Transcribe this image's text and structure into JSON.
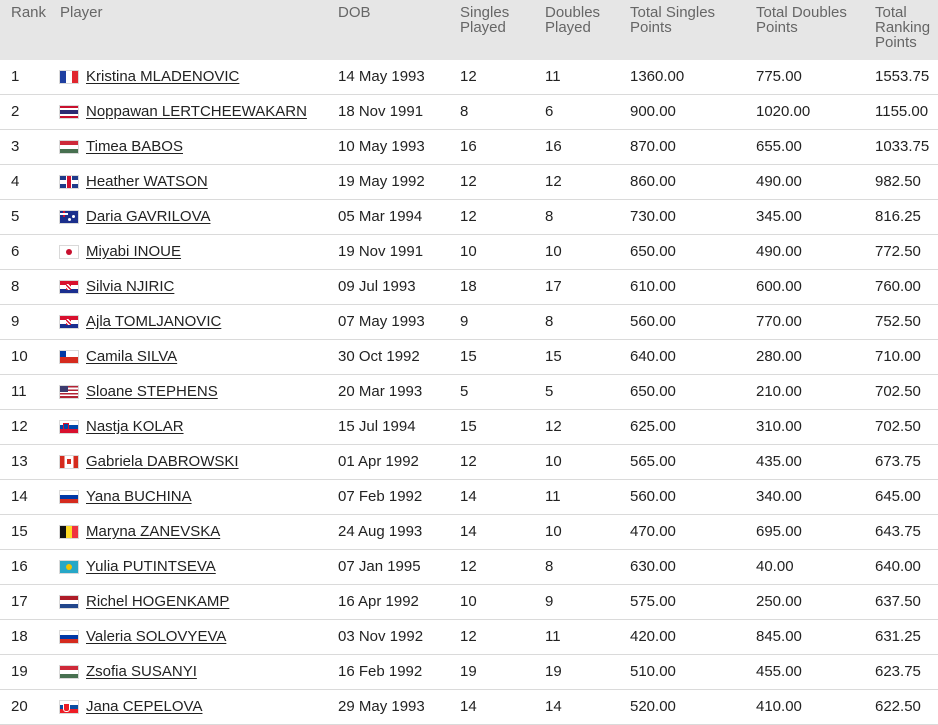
{
  "headers": {
    "rank": "Rank",
    "player": "Player",
    "dob": "DOB",
    "singles_played": "Singles\nPlayed",
    "doubles_played": "Doubles\nPlayed",
    "total_singles": "Total Singles\nPoints",
    "total_doubles": "Total Doubles\nPoints",
    "total_ranking": "Total\nRanking\nPoints"
  },
  "rows": [
    {
      "rank": "1",
      "flag": "fr",
      "flag_icon": "france-flag-icon",
      "player": "Kristina MLADENOVIC",
      "dob": "14 May 1993",
      "singles_played": "12",
      "doubles_played": "11",
      "total_singles": "1360.00",
      "total_doubles": "775.00",
      "total_ranking": "1553.75"
    },
    {
      "rank": "2",
      "flag": "th",
      "flag_icon": "thailand-flag-icon",
      "player": "Noppawan LERTCHEEWAKARN",
      "dob": "18 Nov 1991",
      "singles_played": "8",
      "doubles_played": "6",
      "total_singles": "900.00",
      "total_doubles": "1020.00",
      "total_ranking": "1155.00"
    },
    {
      "rank": "3",
      "flag": "hu",
      "flag_icon": "hungary-flag-icon",
      "player": "Timea BABOS",
      "dob": "10 May 1993",
      "singles_played": "16",
      "doubles_played": "16",
      "total_singles": "870.00",
      "total_doubles": "655.00",
      "total_ranking": "1033.75"
    },
    {
      "rank": "4",
      "flag": "gb",
      "flag_icon": "great-britain-flag-icon",
      "player": "Heather WATSON",
      "dob": "19 May 1992",
      "singles_played": "12",
      "doubles_played": "12",
      "total_singles": "860.00",
      "total_doubles": "490.00",
      "total_ranking": "982.50"
    },
    {
      "rank": "5",
      "flag": "au",
      "flag_icon": "australia-flag-icon",
      "player": "Daria GAVRILOVA",
      "dob": "05 Mar 1994",
      "singles_played": "12",
      "doubles_played": "8",
      "total_singles": "730.00",
      "total_doubles": "345.00",
      "total_ranking": "816.25"
    },
    {
      "rank": "6",
      "flag": "jp",
      "flag_icon": "japan-flag-icon",
      "player": "Miyabi INOUE",
      "dob": "19 Nov 1991",
      "singles_played": "10",
      "doubles_played": "10",
      "total_singles": "650.00",
      "total_doubles": "490.00",
      "total_ranking": "772.50"
    },
    {
      "rank": "8",
      "flag": "hr",
      "flag_icon": "croatia-flag-icon",
      "player": "Silvia NJIRIC",
      "dob": "09 Jul 1993",
      "singles_played": "18",
      "doubles_played": "17",
      "total_singles": "610.00",
      "total_doubles": "600.00",
      "total_ranking": "760.00"
    },
    {
      "rank": "9",
      "flag": "hr",
      "flag_icon": "croatia-flag-icon",
      "player": "Ajla TOMLJANOVIC",
      "dob": "07 May 1993",
      "singles_played": "9",
      "doubles_played": "8",
      "total_singles": "560.00",
      "total_doubles": "770.00",
      "total_ranking": "752.50"
    },
    {
      "rank": "10",
      "flag": "cl",
      "flag_icon": "chile-flag-icon",
      "player": "Camila SILVA",
      "dob": "30 Oct 1992",
      "singles_played": "15",
      "doubles_played": "15",
      "total_singles": "640.00",
      "total_doubles": "280.00",
      "total_ranking": "710.00"
    },
    {
      "rank": "11",
      "flag": "us",
      "flag_icon": "usa-flag-icon",
      "player": "Sloane STEPHENS",
      "dob": "20 Mar 1993",
      "singles_played": "5",
      "doubles_played": "5",
      "total_singles": "650.00",
      "total_doubles": "210.00",
      "total_ranking": "702.50"
    },
    {
      "rank": "12",
      "flag": "si",
      "flag_icon": "slovenia-flag-icon",
      "player": "Nastja KOLAR",
      "dob": "15 Jul 1994",
      "singles_played": "15",
      "doubles_played": "12",
      "total_singles": "625.00",
      "total_doubles": "310.00",
      "total_ranking": "702.50"
    },
    {
      "rank": "13",
      "flag": "ca",
      "flag_icon": "canada-flag-icon",
      "player": "Gabriela DABROWSKI",
      "dob": "01 Apr 1992",
      "singles_played": "12",
      "doubles_played": "10",
      "total_singles": "565.00",
      "total_doubles": "435.00",
      "total_ranking": "673.75"
    },
    {
      "rank": "14",
      "flag": "ru",
      "flag_icon": "russia-flag-icon",
      "player": "Yana BUCHINA",
      "dob": "07 Feb 1992",
      "singles_played": "14",
      "doubles_played": "11",
      "total_singles": "560.00",
      "total_doubles": "340.00",
      "total_ranking": "645.00"
    },
    {
      "rank": "15",
      "flag": "be",
      "flag_icon": "belgium-flag-icon",
      "player": "Maryna ZANEVSKA",
      "dob": "24 Aug 1993",
      "singles_played": "14",
      "doubles_played": "10",
      "total_singles": "470.00",
      "total_doubles": "695.00",
      "total_ranking": "643.75"
    },
    {
      "rank": "16",
      "flag": "kz",
      "flag_icon": "kazakhstan-flag-icon",
      "player": "Yulia PUTINTSEVA",
      "dob": "07 Jan 1995",
      "singles_played": "12",
      "doubles_played": "8",
      "total_singles": "630.00",
      "total_doubles": "40.00",
      "total_ranking": "640.00"
    },
    {
      "rank": "17",
      "flag": "nl",
      "flag_icon": "netherlands-flag-icon",
      "player": "Richel HOGENKAMP",
      "dob": "16 Apr 1992",
      "singles_played": "10",
      "doubles_played": "9",
      "total_singles": "575.00",
      "total_doubles": "250.00",
      "total_ranking": "637.50"
    },
    {
      "rank": "18",
      "flag": "ru",
      "flag_icon": "russia-flag-icon",
      "player": "Valeria SOLOVYEVA",
      "dob": "03 Nov 1992",
      "singles_played": "12",
      "doubles_played": "11",
      "total_singles": "420.00",
      "total_doubles": "845.00",
      "total_ranking": "631.25"
    },
    {
      "rank": "19",
      "flag": "hu",
      "flag_icon": "hungary-flag-icon",
      "player": "Zsofia SUSANYI",
      "dob": "16 Feb 1992",
      "singles_played": "19",
      "doubles_played": "19",
      "total_singles": "510.00",
      "total_doubles": "455.00",
      "total_ranking": "623.75"
    },
    {
      "rank": "20",
      "flag": "sk",
      "flag_icon": "slovakia-flag-icon",
      "player": "Jana CEPELOVA",
      "dob": "29 May 1993",
      "singles_played": "14",
      "doubles_played": "14",
      "total_singles": "520.00",
      "total_doubles": "410.00",
      "total_ranking": "622.50"
    }
  ],
  "colors": {
    "header_bg": "#e6e6e6",
    "header_text": "#666666",
    "row_text": "#222222",
    "row_divider": "#dadada"
  }
}
